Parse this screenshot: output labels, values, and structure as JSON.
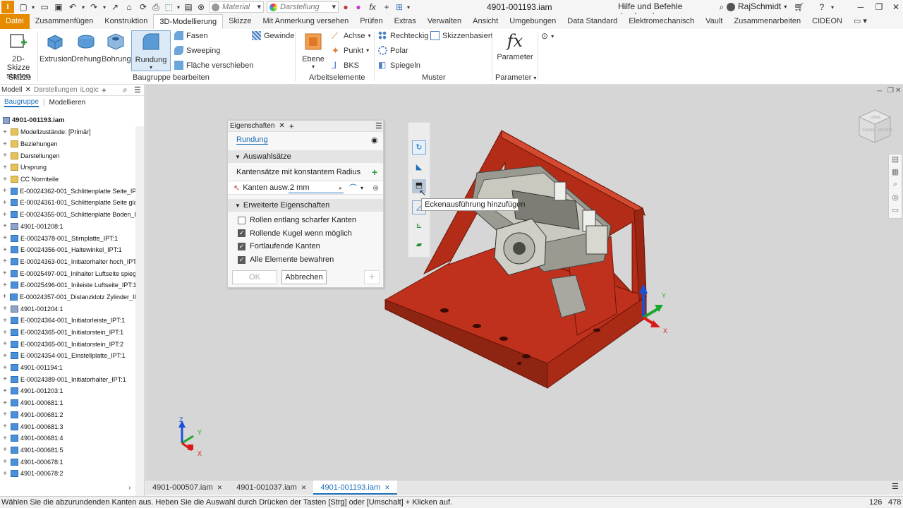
{
  "titlebar": {
    "material_placeholder": "Material",
    "appearance_placeholder": "Darstellung",
    "doc_title": "4901-001193.iam",
    "search_text": "Hilfe und Befehle durchsuchen...",
    "user": "RajSchmidt",
    "fx_label": "fx"
  },
  "menu_tabs": [
    "Datei",
    "Zusammenfügen",
    "Konstruktion",
    "3D-Modellierung",
    "Skizze",
    "Mit Anmerkung versehen",
    "Prüfen",
    "Extras",
    "Verwalten",
    "Ansicht",
    "Umgebungen",
    "Data Standard",
    "Elektromechanisch",
    "Vault",
    "Zusammenarbeiten",
    "CIDEON"
  ],
  "ribbon": {
    "sketch_start_1": "2D-Skizze",
    "sketch_start_2": "starten",
    "extrusion": "Extrusion",
    "rotation": "Drehung",
    "bore": "Bohrung",
    "fillet": "Rundung",
    "chamfer": "Fasen",
    "sweep": "Sweeping",
    "move_face": "Fläche verschieben",
    "thread": "Gewinde",
    "plane": "Ebene",
    "axis": "Achse",
    "point": "Punkt",
    "ucs": "BKS",
    "rectangular": "Rechteckig",
    "sketch_based": "Skizzenbasiert",
    "polar": "Polar",
    "mirror": "Spiegeln",
    "parameter": "Parameter",
    "fx": "fx",
    "group_sketch": "Skizze",
    "group_modify": "Baugruppe bearbeiten",
    "group_work": "Arbeitselemente",
    "group_pattern": "Muster",
    "group_param": "Parameter"
  },
  "browser": {
    "tab_model": "Modell",
    "tab_views": "Darstellungen",
    "tab_ilogic": "iLogic",
    "sub_assembly": "Baugruppe",
    "sub_modeling": "Modellieren",
    "root": "4901-001193.iam",
    "items": [
      {
        "label": "Modellzustände: [Primär]",
        "icon": "folder"
      },
      {
        "label": "Beziehungen",
        "icon": "folder"
      },
      {
        "label": "Darstellungen",
        "icon": "folder"
      },
      {
        "label": "Ursprung",
        "icon": "folder"
      },
      {
        "label": "CC Normteile",
        "icon": "folder"
      },
      {
        "label": "E-00024362-001_Schlittenplatte Seite_IPT",
        "icon": "part"
      },
      {
        "label": "E-00024361-001_Schlittenplatte Seite glat",
        "icon": "part"
      },
      {
        "label": "E-00024355-001_Schlittenplatte Boden_IP",
        "icon": "part"
      },
      {
        "label": "4901-001208:1",
        "icon": "asm"
      },
      {
        "label": "E-00024378-001_Stirnplatte_IPT:1",
        "icon": "part"
      },
      {
        "label": "E-00024356-001_Haltewinkel_IPT:1",
        "icon": "part"
      },
      {
        "label": "E-00024363-001_Initiatorhalter hoch_IPT:",
        "icon": "part"
      },
      {
        "label": "E-00025497-001_Inihalter Luftseite spiege",
        "icon": "part"
      },
      {
        "label": "E-00025496-001_Inileiste Luftseite_IPT:1",
        "icon": "part"
      },
      {
        "label": "E-00024357-001_Distanzklotz Zylinder_IPT",
        "icon": "part"
      },
      {
        "label": "4901-001204:1",
        "icon": "asm"
      },
      {
        "label": "E-00024364-001_Initiatorleiste_IPT:1",
        "icon": "part"
      },
      {
        "label": "E-00024365-001_Initiatorstein_IPT:1",
        "icon": "part"
      },
      {
        "label": "E-00024365-001_Initiatorstein_IPT:2",
        "icon": "part"
      },
      {
        "label": "E-00024354-001_Einstellplatte_IPT:1",
        "icon": "part"
      },
      {
        "label": "4901-001194:1",
        "icon": "part"
      },
      {
        "label": "E-00024389-001_Initiatorhalter_IPT:1",
        "icon": "part"
      },
      {
        "label": "4901-001203:1",
        "icon": "part"
      },
      {
        "label": "4901-000681:1",
        "icon": "part"
      },
      {
        "label": "4901-000681:2",
        "icon": "part"
      },
      {
        "label": "4901-000681:3",
        "icon": "part"
      },
      {
        "label": "4901-000681:4",
        "icon": "part"
      },
      {
        "label": "4901-000681:5",
        "icon": "part"
      },
      {
        "label": "4901-000678:1",
        "icon": "part"
      },
      {
        "label": "4901-000678:2",
        "icon": "part"
      }
    ]
  },
  "panel": {
    "tab": "Eigenschaften",
    "feature": "Rundung",
    "section_selection": "Auswahlsätze",
    "const_radius": "Kantensätze mit konstantem Radius",
    "edges_select": "Kanten ausw...",
    "radius_value": "2 mm",
    "section_advanced": "Erweiterte Eigenschaften",
    "options": [
      {
        "label": "Rollen entlang scharfer Kanten",
        "checked": false
      },
      {
        "label": "Rollende Kugel wenn möglich",
        "checked": true
      },
      {
        "label": "Fortlaufende Kanten",
        "checked": true
      },
      {
        "label": "Alle Elemente bewahren",
        "checked": true
      }
    ],
    "ok": "OK",
    "cancel": "Abbrechen"
  },
  "tooltip": "Eckenausführung hinzufügen",
  "viewcube": {
    "top": "OBEN",
    "front": "VORNE",
    "right": "RECHTS"
  },
  "axes": {
    "x": "X",
    "y": "Y",
    "z": "Z"
  },
  "doc_tabs": [
    {
      "label": "4901-000507.iam",
      "active": false
    },
    {
      "label": "4901-001037.iam",
      "active": false
    },
    {
      "label": "4901-001193.iam",
      "active": true
    }
  ],
  "status": {
    "message": "Wählen Sie die abzurundenden Kanten aus. Heben Sie die Auswahl durch Drücken der Tasten [Strg] oder [Umschalt] + Klicken auf.",
    "n1": "126",
    "n2": "478"
  },
  "colors": {
    "accent": "#1d6fb8",
    "file_tab": "#e68a00",
    "part_red": "#c0311d"
  }
}
